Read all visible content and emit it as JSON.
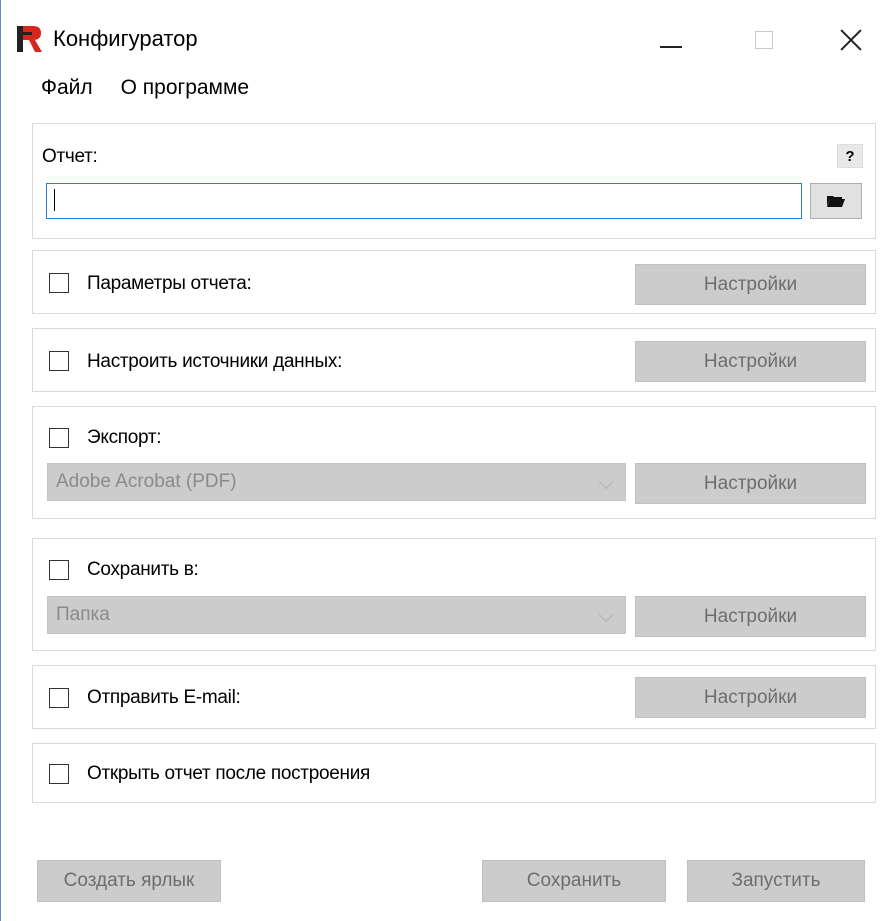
{
  "window": {
    "title": "Конфигуратор",
    "icon": "fastreport-logo-icon",
    "controls": [
      "minimize-icon",
      "maximize-icon",
      "close-icon"
    ]
  },
  "menu": {
    "items": [
      "Файл",
      "О программе"
    ]
  },
  "report": {
    "label": "Отчет:",
    "help": "?",
    "path_value": "",
    "browse_icon": "folder-open-icon"
  },
  "sections": {
    "params": {
      "label": "Параметры отчета:",
      "checked": false,
      "button": "Настройки"
    },
    "datasources": {
      "label": "Настроить источники данных:",
      "checked": false,
      "button": "Настройки"
    },
    "export": {
      "label": "Экспорт:",
      "checked": false,
      "selected": "Adobe Acrobat (PDF)",
      "button": "Настройки"
    },
    "save": {
      "label": "Сохранить в:",
      "checked": false,
      "selected": "Папка",
      "button": "Настройки"
    },
    "email": {
      "label": "Отправить E-mail:",
      "checked": false,
      "button": "Настройки"
    },
    "open_after": {
      "label": "Открыть отчет после построения",
      "checked": false
    }
  },
  "footer": {
    "create_shortcut": "Создать ярлык",
    "save": "Сохранить",
    "run": "Запустить"
  },
  "colors": {
    "disabled_bg": "#cccccc",
    "disabled_text": "#6d6d6d",
    "focus_border": "#2d7ad5",
    "logo_red": "#d9261c"
  }
}
